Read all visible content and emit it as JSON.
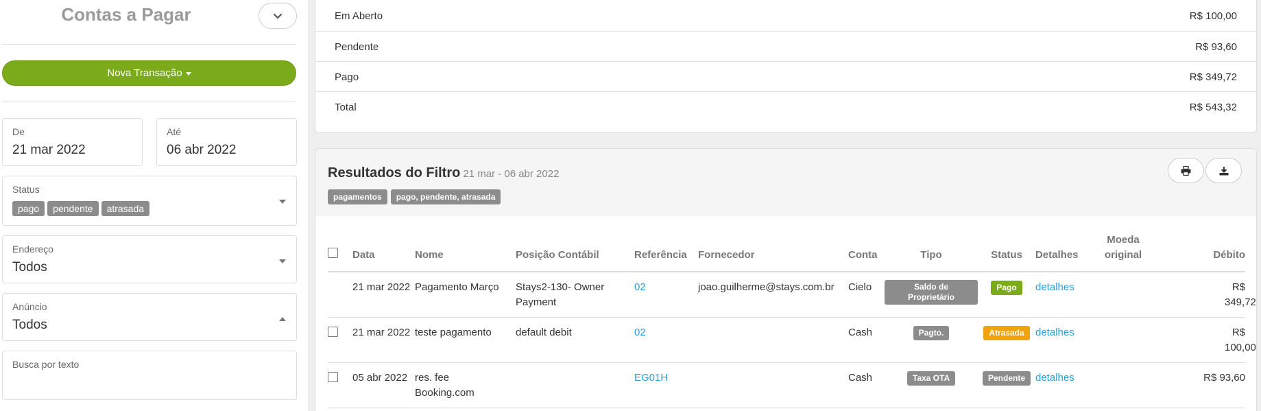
{
  "sidebar": {
    "title": "Contas a Pagar",
    "new_transaction_label": "Nova Transação",
    "from": {
      "label": "De",
      "value": "21 mar 2022"
    },
    "to": {
      "label": "Até",
      "value": "06 abr 2022"
    },
    "status": {
      "label": "Status",
      "chips": [
        "pago",
        "pendente",
        "atrasada"
      ]
    },
    "address": {
      "label": "Endereço",
      "value": "Todos"
    },
    "listing": {
      "label": "Anúncio",
      "value": "Todos"
    },
    "search": {
      "label": "Busca por texto"
    }
  },
  "summary": {
    "rows": [
      {
        "label": "Em Aberto",
        "value": "R$ 100,00"
      },
      {
        "label": "Pendente",
        "value": "R$ 93,60"
      },
      {
        "label": "Pago",
        "value": "R$ 349,72"
      },
      {
        "label": "Total",
        "value": "R$ 543,32"
      }
    ]
  },
  "results": {
    "title": "Resultados do Filtro",
    "range": "21 mar - 06 abr 2022",
    "chips": [
      "pagamentos",
      "pago, pendente, atrasada"
    ],
    "columns": {
      "data": "Data",
      "nome": "Nome",
      "posicao": "Posição Contábil",
      "referencia": "Referência",
      "fornecedor": "Fornecedor",
      "conta": "Conta",
      "tipo": "Tipo",
      "status": "Status",
      "detalhes": "Detalhes",
      "moeda": "Moeda original",
      "debito": "Débito"
    },
    "rows": [
      {
        "data": "21 mar 2022",
        "nome": "Pagamento Março",
        "posicao": "Stays2-130- Owner Payment",
        "referencia": "02",
        "fornecedor": "joao.guilherme@stays.com.br",
        "conta": "Cielo",
        "tipo": "Saldo de Proprietário",
        "status": "Pago",
        "detalhes": "detalhes",
        "debito": "R$ 349,72"
      },
      {
        "data": "21 mar 2022",
        "nome": "teste pagamento",
        "posicao": "default debit",
        "referencia": "02",
        "fornecedor": "",
        "conta": "Cash",
        "tipo": "Pagto.",
        "status": "Atrasada",
        "detalhes": "detalhes",
        "debito": "R$ 100,00"
      },
      {
        "data": "05 abr 2022",
        "nome": "res. fee Booking.com",
        "posicao": "",
        "referencia": "EG01H",
        "fornecedor": "",
        "conta": "Cash",
        "tipo": "Taxa OTA",
        "status": "Pendente",
        "detalhes": "detalhes",
        "debito": "R$ 93,60"
      }
    ]
  },
  "colors": {
    "accent_green": "#7bab1b",
    "status_pago": "#7bab1b",
    "status_atrasada": "#f0a30a",
    "status_pendente": "#8c8c8c",
    "link": "#2a9fd6"
  },
  "icons": [
    "chevron-down-icon",
    "caret-down-icon",
    "print-icon",
    "download-icon"
  ]
}
